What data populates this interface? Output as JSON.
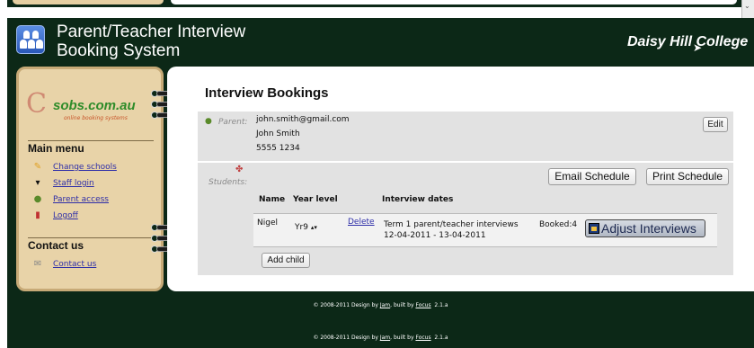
{
  "header": {
    "title": "Parent/Teacher Interview\nBooking System",
    "college": "Daisy Hill College"
  },
  "sidebar": {
    "logo": {
      "name": "sobs.com.au",
      "tagline": "online booking systems"
    },
    "main_menu_heading": "Main menu",
    "main_menu": [
      {
        "label": "Change schools",
        "icon": "pencil-icon"
      },
      {
        "label": "Staff login",
        "icon": "graduation-cap-icon"
      },
      {
        "label": "Parent access",
        "icon": "person-icon"
      },
      {
        "label": "Logoff",
        "icon": "logoff-door-icon"
      }
    ],
    "contact_heading": "Contact us",
    "contact_link": "Contact us"
  },
  "content": {
    "title": "Interview Bookings",
    "parent": {
      "label": "Parent:",
      "email": "john.smith@gmail.com",
      "name": "John Smith",
      "phone": "5555 1234",
      "edit_label": "Edit"
    },
    "students": {
      "label": "Students:",
      "email_schedule_label": "Email Schedule",
      "print_schedule_label": "Print Schedule",
      "columns": [
        "Name",
        "Year level",
        "Interview dates"
      ],
      "rows": [
        {
          "name": "Nigel",
          "year_level": "Yr9",
          "delete_label": "Delete",
          "interview_name": "Term 1 parent/teacher interviews",
          "interview_dates": "12-04-2011 - 13-04-2011",
          "booked": "Booked:4",
          "adjust_label": "Adjust Interviews"
        }
      ],
      "add_child_label": "Add child"
    }
  },
  "footer": {
    "prefix": "© 2008-2011 Design by ",
    "design_by": "Jam",
    "built_by_text": ", built by ",
    "built_by": "Focus",
    "version": "2.1.a"
  },
  "colors": {
    "frame": "#0c2817",
    "sidebar": "#e8d3a8",
    "panel": "#e2e2e2",
    "link": "#2e2ea8"
  }
}
